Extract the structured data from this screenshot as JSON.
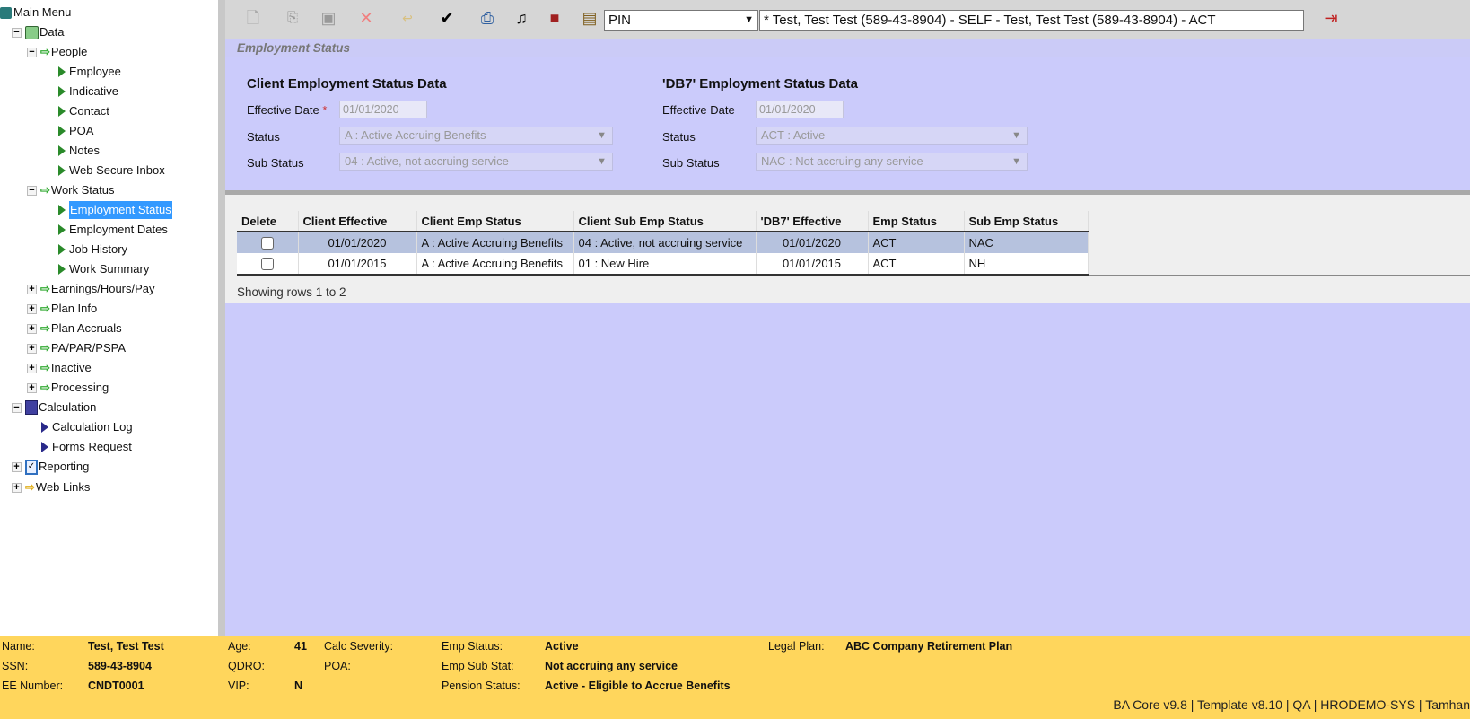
{
  "sidebar": {
    "main_menu": "Main Menu",
    "data": "Data",
    "people": "People",
    "people_items": [
      "Employee",
      "Indicative",
      "Contact",
      "POA",
      "Notes",
      "Web Secure Inbox"
    ],
    "work_status": "Work Status",
    "work_items": [
      "Employment Status",
      "Employment Dates",
      "Job History",
      "Work Summary"
    ],
    "groups": [
      "Earnings/Hours/Pay",
      "Plan Info",
      "Plan Accruals",
      "PA/PAR/PSPA",
      "Inactive",
      "Processing"
    ],
    "calculation": "Calculation",
    "calc_items": [
      "Calculation Log",
      "Forms Request"
    ],
    "reporting": "Reporting",
    "web_links": "Web Links",
    "selected": "Employment Status"
  },
  "toolbar": {
    "pin_select": "PIN",
    "participant": "* Test, Test Test (589-43-8904) - SELF - Test, Test Test (589-43-8904) - ACT"
  },
  "page_title": "Employment Status",
  "client": {
    "heading": "Client Employment Status Data",
    "eff_label": "Effective Date",
    "required": "*",
    "eff_value": "01/01/2020",
    "status_label": "Status",
    "status_value": "A : Active Accruing Benefits",
    "sub_label": "Sub Status",
    "sub_value": "04 : Active, not accruing service"
  },
  "db7": {
    "heading": "'DB7' Employment Status Data",
    "eff_label": "Effective Date",
    "eff_value": "01/01/2020",
    "status_label": "Status",
    "status_value": "ACT : Active",
    "sub_label": "Sub Status",
    "sub_value": "NAC : Not accruing any service"
  },
  "table": {
    "headers": [
      "Delete",
      "Client Effective",
      "Client Emp Status",
      "Client Sub Emp Status",
      "'DB7' Effective",
      "Emp Status",
      "Sub Emp Status"
    ],
    "rows": [
      {
        "client_eff": "01/01/2020",
        "client_status": "A : Active Accruing Benefits",
        "client_sub": "04 : Active, not accruing service",
        "db7_eff": "01/01/2020",
        "emp_status": "ACT",
        "sub_status": "NAC"
      },
      {
        "client_eff": "01/01/2015",
        "client_status": "A : Active Accruing Benefits",
        "client_sub": "01 : New Hire",
        "db7_eff": "01/01/2015",
        "emp_status": "ACT",
        "sub_status": "NH"
      }
    ],
    "showing": "Showing rows 1 to 2"
  },
  "footer": {
    "name_label": "Name:",
    "name": "Test, Test Test",
    "ssn_label": "SSN:",
    "ssn": "589-43-8904",
    "ee_label": "EE Number:",
    "ee": "CNDT0001",
    "age_label": "Age:",
    "age": "41",
    "qdro_label": "QDRO:",
    "vip_label": "VIP:",
    "vip": "N",
    "calc_sev_label": "Calc Severity:",
    "poa_label": "POA:",
    "emp_status_label": "Emp Status:",
    "emp_status": "Active",
    "emp_sub_label": "Emp Sub Stat:",
    "emp_sub": "Not accruing any service",
    "pension_label": "Pension Status:",
    "pension": "Active - Eligible to Accrue Benefits",
    "legal_label": "Legal Plan:",
    "legal": "ABC Company Retirement Plan",
    "version": "BA Core v9.8 | Template v8.10 | QA | HRODEMO-SYS | Tamhan"
  }
}
